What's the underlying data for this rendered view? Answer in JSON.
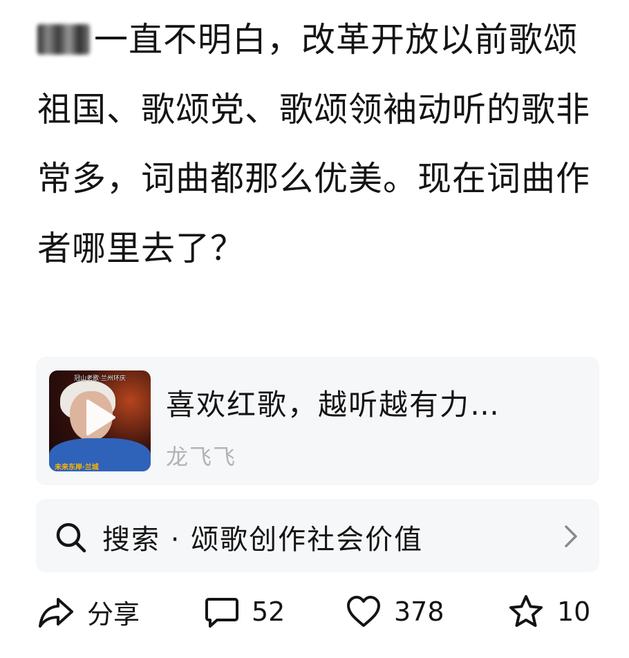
{
  "post": {
    "masked_prefix_note": "",
    "text": "一直不明白，改革开放以前歌颂祖国、歌颂党、歌颂领袖动听的歌非常多，词曲都那么优美。现在词曲作者哪里去了？"
  },
  "video_card": {
    "thumbnail_caption": "冠山老歌·兰州环庆",
    "thumbnail_bottom_text": "未来东岸·兰城",
    "title": "喜欢红歌，越听越有力…",
    "author": "龙飞飞"
  },
  "search": {
    "label": "搜索 · 颂歌创作社会价值"
  },
  "actions": {
    "share_label": "分享",
    "comment_count": "52",
    "like_count": "378",
    "favorite_count": "10"
  },
  "icons": {
    "share": "share-icon",
    "comment": "comment-icon",
    "like": "heart-icon",
    "favorite": "star-icon",
    "search": "search-icon",
    "play": "play-icon",
    "chevron": "chevron-right-icon"
  }
}
